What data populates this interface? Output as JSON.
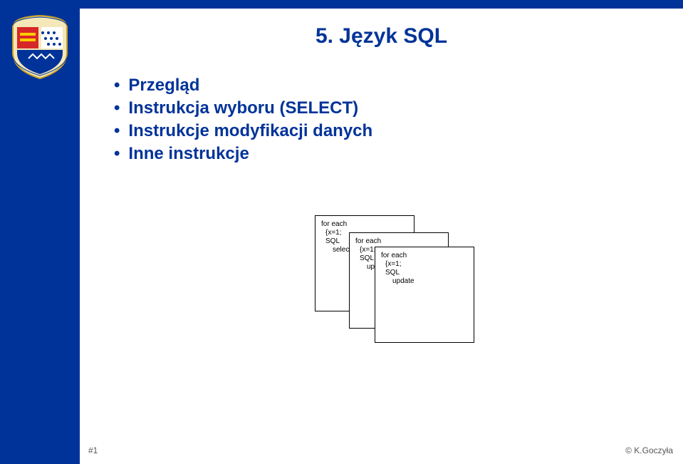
{
  "title": "5. Język SQL",
  "bullets": {
    "items": [
      {
        "label": "Przegląd"
      },
      {
        "label": "Instrukcja wyboru (SELECT)"
      },
      {
        "label": "Instrukcje modyfikacji danych"
      },
      {
        "label": "Inne instrukcje"
      }
    ]
  },
  "code_boxes": {
    "box1": {
      "l1": "for each",
      "l2": "{x=1;",
      "l3": "SQL",
      "l4": "select"
    },
    "box2": {
      "l1": "for each",
      "l2": "{x=1;",
      "l3": "SQL",
      "l4": "update"
    },
    "box3": {
      "l1": "for each",
      "l2": "{x=1;",
      "l3": "SQL",
      "l4": "update"
    }
  },
  "footer": {
    "left": "#1",
    "right": "© K.Goczyła"
  }
}
